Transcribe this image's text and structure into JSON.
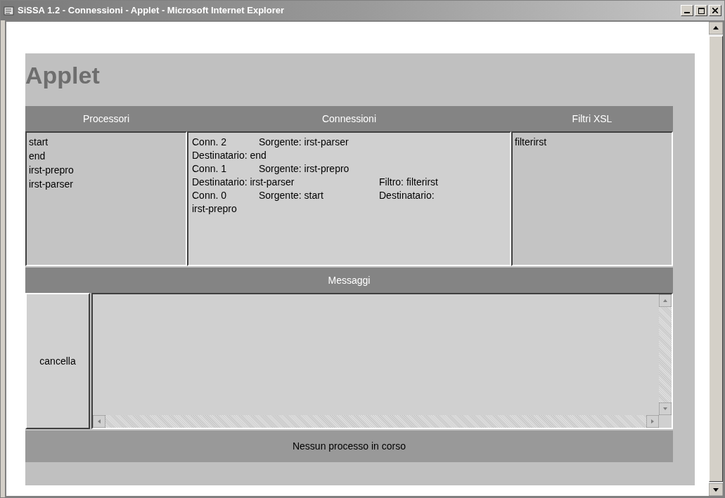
{
  "window": {
    "title": "SiSSA 1.2 - Connessioni - Applet - Microsoft Internet Explorer"
  },
  "heading": "Applet",
  "columns": [
    "Processori",
    "Connessioni",
    "Filtri XSL"
  ],
  "processori": [
    "start",
    "end",
    "irst-prepro",
    "irst-parser"
  ],
  "connessioni": [
    {
      "col_1": "Conn. 2",
      "col_2": "Sorgente: irst-parser"
    },
    {
      "col_1": "Destinatario: end"
    },
    {
      "col_1": "Conn. 1",
      "col_2": "Sorgente: irst-prepro"
    },
    {
      "col_1": "Destinatario: irst-parser",
      "col_3": "Filtro: filterirst"
    },
    {
      "col_1": "Conn. 0",
      "col_2": "Sorgente: start",
      "col_3": "Destinatario:"
    },
    {
      "col_1": "irst-prepro"
    }
  ],
  "filtri": [
    "filterirst"
  ],
  "messaggi": {
    "title": "Messaggi",
    "button": "cancella"
  },
  "status": "Nessun processo in corso"
}
